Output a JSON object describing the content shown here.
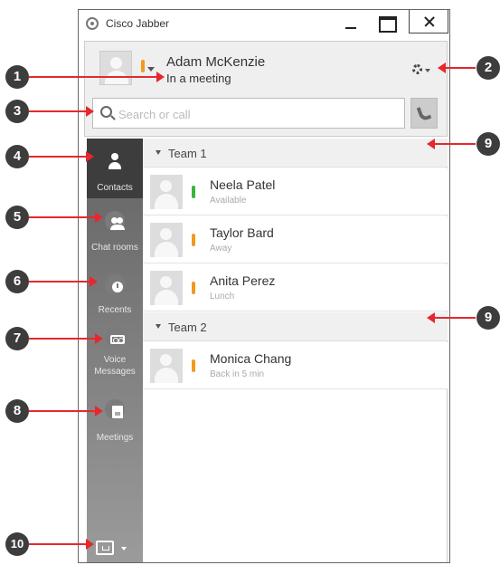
{
  "window": {
    "title": "Cisco Jabber"
  },
  "header": {
    "user_name": "Adam McKenzie",
    "user_status": "In a meeting",
    "search_placeholder": "Search or call"
  },
  "sidebar": {
    "items": [
      {
        "label": "Contacts",
        "icon": "person-icon",
        "active": true
      },
      {
        "label": "Chat rooms",
        "icon": "chat-rooms-icon"
      },
      {
        "label": "Recents",
        "icon": "clock-icon"
      },
      {
        "label": "Voice Messages",
        "icon": "voicemail-icon"
      },
      {
        "label": "Meetings",
        "icon": "calendar-icon"
      }
    ]
  },
  "groups": [
    {
      "name": "Team 1",
      "contacts": [
        {
          "name": "Neela Patel",
          "status": "Available",
          "presence_color": "#3cb43c"
        },
        {
          "name": "Taylor Bard",
          "status": "Away",
          "presence_color": "#f39a1e"
        },
        {
          "name": "Anita Perez",
          "status": "Lunch",
          "presence_color": "#f39a1e"
        }
      ]
    },
    {
      "name": "Team 2",
      "contacts": [
        {
          "name": "Monica Chang",
          "status": "Back in 5 min",
          "presence_color": "#f39a1e"
        }
      ]
    }
  ],
  "callouts": [
    "1",
    "2",
    "3",
    "4",
    "5",
    "6",
    "7",
    "8",
    "9",
    "9",
    "10"
  ],
  "colors": {
    "arrow": "#e5282d",
    "callout_bg": "#3d3d3d",
    "presence_away": "#f39a1e",
    "presence_available": "#3cb43c"
  }
}
